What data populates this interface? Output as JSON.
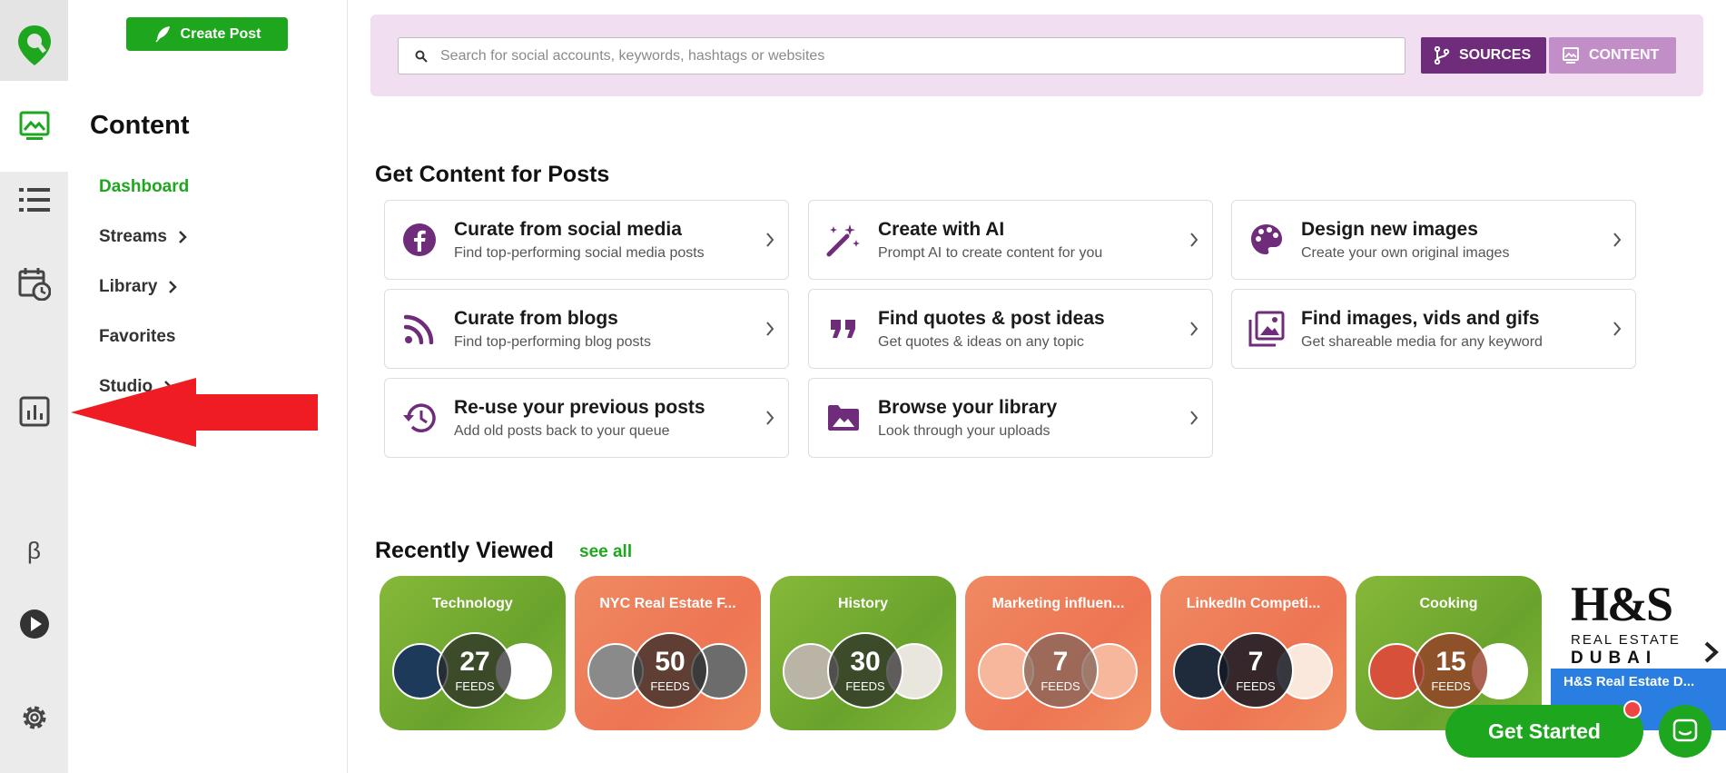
{
  "side": {
    "create_post": "Create Post",
    "title": "Content",
    "nav": [
      "Dashboard",
      "Streams",
      "Library",
      "Favorites",
      "Studio"
    ]
  },
  "rail_icons": [
    "logo-pin-icon",
    "content-image-icon",
    "list-icon",
    "calendar-clock-icon",
    "analytics-icon",
    "beta-icon",
    "play-icon",
    "gear-icon"
  ],
  "beta_symbol": "β",
  "search": {
    "placeholder": "Search for social accounts, keywords, hashtags or websites",
    "sources": "SOURCES",
    "content": "CONTENT"
  },
  "colors": {
    "brand_green": "#1ea71e",
    "purple": "#6e2c7a",
    "light_purple": "#c28ec8",
    "search_bg": "#f1dff1",
    "alert_red": "#ef1c24"
  },
  "get_content": {
    "heading": "Get Content for Posts",
    "cards": [
      {
        "title": "Curate from social media",
        "desc": "Find top-performing social media posts",
        "icon": "facebook-icon"
      },
      {
        "title": "Create with AI",
        "desc": "Prompt AI to create content for you",
        "icon": "magic-wand-icon"
      },
      {
        "title": "Design new images",
        "desc": "Create your own original images",
        "icon": "palette-icon"
      },
      {
        "title": "Curate from blogs",
        "desc": "Find top-performing blog posts",
        "icon": "rss-icon"
      },
      {
        "title": "Find quotes & post ideas",
        "desc": "Get quotes & ideas on any topic",
        "icon": "quote-icon"
      },
      {
        "title": "Find images, vids and gifs",
        "desc": "Get shareable media for any keyword",
        "icon": "images-icon"
      },
      {
        "title": "Re-use your previous posts",
        "desc": "Add old posts back to your queue",
        "icon": "history-icon"
      },
      {
        "title": "Browse your library",
        "desc": "Look through your uploads",
        "icon": "image-folder-icon"
      }
    ]
  },
  "recent": {
    "heading": "Recently Viewed",
    "see_all": "see all",
    "feeds_label": "FEEDS",
    "tiles": [
      {
        "title": "Technology",
        "count": "27",
        "color": "green"
      },
      {
        "title": "NYC Real Estate F...",
        "count": "50",
        "color": "orange"
      },
      {
        "title": "History",
        "count": "30",
        "color": "green"
      },
      {
        "title": "Marketing influen...",
        "count": "7",
        "color": "orange"
      },
      {
        "title": "LinkedIn Competi...",
        "count": "7",
        "color": "orange"
      },
      {
        "title": "Cooking",
        "count": "15",
        "color": "green"
      }
    ],
    "partial_tile": {
      "title": "H&S Real Estate D...",
      "logo_text": "H&S",
      "logo_sub1": "REAL ESTATE",
      "logo_sub2": "DUBAI"
    }
  },
  "get_started": "Get Started"
}
